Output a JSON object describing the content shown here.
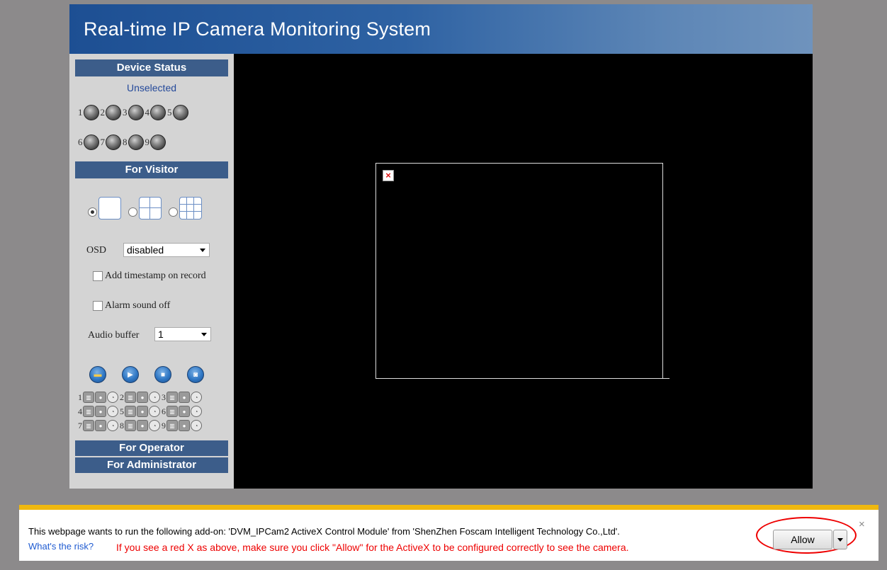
{
  "header": {
    "title": "Real-time IP Camera Monitoring System"
  },
  "sidebar": {
    "device_status": {
      "heading": "Device Status",
      "state": "Unselected",
      "devices_row1": [
        "1",
        "2",
        "3",
        "4",
        "5"
      ],
      "devices_row2": [
        "6",
        "7",
        "8",
        "9"
      ]
    },
    "visitor": {
      "heading": "For Visitor",
      "osd_label": "OSD",
      "osd_value": "disabled",
      "timestamp_label": "Add timestamp on record",
      "alarm_label": "Alarm sound off",
      "audio_buffer_label": "Audio buffer",
      "audio_buffer_value": "1",
      "channels": [
        [
          "1",
          "2",
          "3"
        ],
        [
          "4",
          "5",
          "6"
        ],
        [
          "7",
          "8",
          "9"
        ]
      ]
    },
    "operator_heading": "For Operator",
    "admin_heading": "For Administrator"
  },
  "infobar": {
    "message": "This webpage wants to run the following add-on: 'DVM_IPCam2 ActiveX Control Module' from 'ShenZhen Foscam Intelligent Technology Co.,Ltd'.",
    "risk_link": "What's the risk?",
    "note": "If you see a red X as above, make sure you click \"Allow\" for the ActiveX to be configured correctly to see the camera.",
    "allow_label": "Allow",
    "close_glyph": "×"
  },
  "icons": {
    "led": "device-status-led-icon",
    "folder": "folder-icon",
    "play": "play-icon",
    "stop": "stop-icon",
    "snapshot": "camera-icon",
    "broken_image": "broken-image-icon"
  },
  "colors": {
    "header_start": "#1d4f93",
    "section_head": "#3c5d8a",
    "infobar_border": "#efb80f",
    "note_red": "#e00000"
  }
}
